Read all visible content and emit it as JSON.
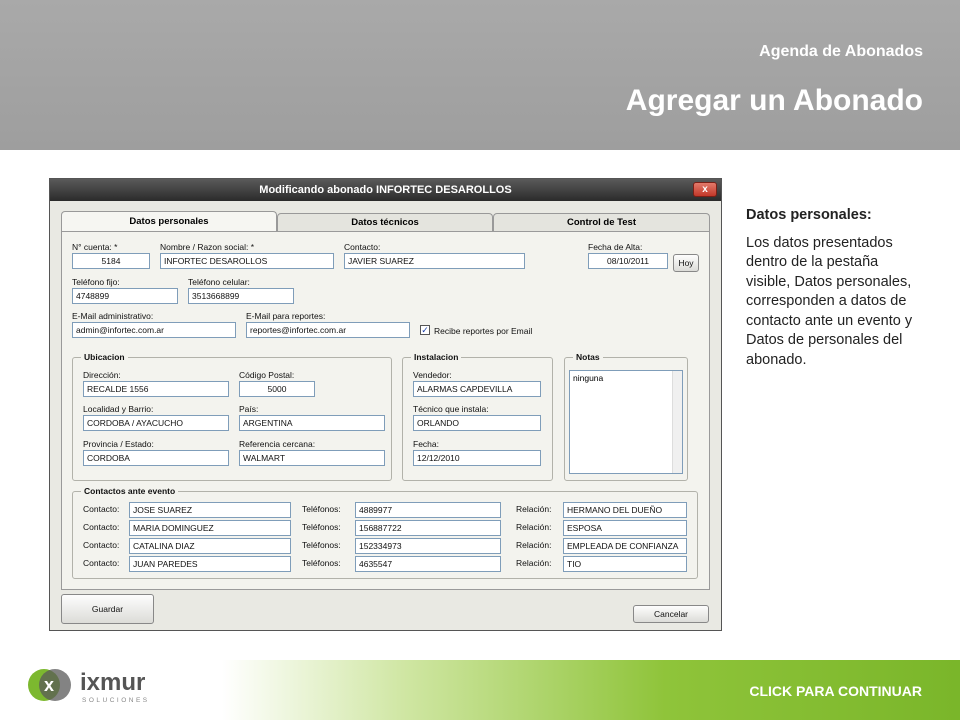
{
  "header": {
    "subtitle": "Agenda de Abonados",
    "title": "Agregar un Abonado"
  },
  "footer": {
    "cta": "CLICK PARA CONTINUAR",
    "brand": "ixmur",
    "brand_sub": "SOLUCIONES"
  },
  "side": {
    "heading": "Datos personales:",
    "body": "Los datos presentados dentro de la pestaña visible, Datos personales, corresponden a datos de contacto ante un evento y Datos de personales del abonado."
  },
  "window": {
    "title": "Modificando abonado INFORTEC DESAROLLOS",
    "close": "x",
    "tabs": [
      "Datos personales",
      "Datos técnicos",
      "Control de Test"
    ],
    "fields": {
      "cuenta_label": "N° cuenta: *",
      "cuenta": "5184",
      "nombre_label": "Nombre / Razon social: *",
      "nombre": "INFORTEC DESAROLLOS",
      "contacto_label": "Contacto:",
      "contacto": "JAVIER SUAREZ",
      "fecha_alta_label": "Fecha de Alta:",
      "fecha_alta": "08/10/2011",
      "hoy": "Hoy",
      "tel_fijo_label": "Teléfono fijo:",
      "tel_fijo": "4748899",
      "tel_cel_label": "Teléfono celular:",
      "tel_cel": "3513668899",
      "email_admin_label": "E-Mail administrativo:",
      "email_admin": "admin@infortec.com.ar",
      "email_rep_label": "E-Mail para reportes:",
      "email_rep": "reportes@infortec.com.ar",
      "recibe_label": "Recibe reportes por Email"
    },
    "ubicacion": {
      "title": "Ubicacion",
      "direccion_label": "Dirección:",
      "direccion": "RECALDE 1556",
      "cp_label": "Código Postal:",
      "cp": "5000",
      "localidad_label": "Localidad y Barrio:",
      "localidad": "CORDOBA / AYACUCHO",
      "pais_label": "País:",
      "pais": "ARGENTINA",
      "provincia_label": "Provincia / Estado:",
      "provincia": "CORDOBA",
      "referencia_label": "Referencia cercana:",
      "referencia": "WALMART"
    },
    "instalacion": {
      "title": "Instalacion",
      "vendedor_label": "Vendedor:",
      "vendedor": "ALARMAS CAPDEVILLA",
      "tecnico_label": "Técnico que instala:",
      "tecnico": "ORLANDO",
      "fecha_label": "Fecha:",
      "fecha": "12/12/2010"
    },
    "notas": {
      "title": "Notas",
      "text": "ninguna"
    },
    "contactos": {
      "title": "Contactos ante evento",
      "contacto_label": "Contacto:",
      "telefonos_label": "Teléfonos:",
      "relacion_label": "Relación:",
      "rows": [
        {
          "nombre": "JOSE SUAREZ",
          "telefono": "4889977",
          "relacion": "HERMANO DEL DUEÑO"
        },
        {
          "nombre": "MARIA DOMINGUEZ",
          "telefono": "156887722",
          "relacion": "ESPOSA"
        },
        {
          "nombre": "CATALINA DIAZ",
          "telefono": "152334973",
          "relacion": "EMPLEADA DE CONFIANZA"
        },
        {
          "nombre": "JUAN PAREDES",
          "telefono": "4635547",
          "relacion": "TIO"
        }
      ]
    },
    "guardar": "Guardar",
    "cancelar": "Cancelar"
  }
}
